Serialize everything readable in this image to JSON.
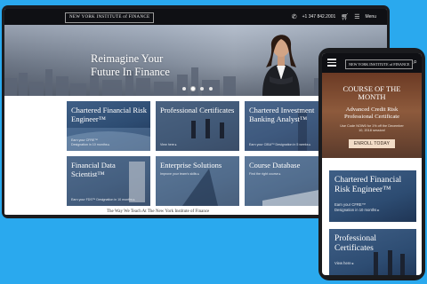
{
  "desktop": {
    "logo": "NEW YORK INSTITUTE of FINANCE",
    "phone": "+1 347 842.2001",
    "menu_label": "Menu",
    "hero_title_1": "Reimagine Your",
    "hero_title_2": "Future In Finance",
    "cards": [
      {
        "title": "Chartered Financial Risk Engineer™",
        "sub1": "Earn your CFRE™",
        "sub2": "Designation in 10 months ▸"
      },
      {
        "title": "Professional Certificates",
        "sub1": "View here ▸",
        "sub2": ""
      },
      {
        "title": "Chartered Investment Banking Analyst™",
        "sub1": "Earn your CIBA™ Designation in 5 weeks ▸",
        "sub2": ""
      },
      {
        "title": "Financial Data Scientist™",
        "sub1": "Earn your FDS™ Designation in 10 months ▸",
        "sub2": ""
      },
      {
        "title": "Enterprise Solutions",
        "sub1": "Improve your team's skills ▸",
        "sub2": ""
      },
      {
        "title": "Course Database",
        "sub1": "Find the right course ▸",
        "sub2": ""
      }
    ],
    "bottom_text": "The Way We Teach At The New York Institute of Finance"
  },
  "mobile": {
    "logo": "NEW YORK INSTITUTE of FINANCE",
    "hero_line_1": "COURSE OF THE",
    "hero_line_2": "MONTH",
    "cert_line_1": "Advanced Credit Risk",
    "cert_line_2": "Professional Certificate",
    "promo_1": "Use Code NOW6 for 1% off the December",
    "promo_2": "10, 2018 session!",
    "cta": "ENROLL TODAY",
    "cards": [
      {
        "title": "Chartered Financial Risk Engineer™",
        "sub1": "Earn your CFRE™",
        "sub2": "Designation in 10 months ▸"
      },
      {
        "title": "Professional Certificates",
        "sub1": "View here ▸",
        "sub2": ""
      }
    ]
  },
  "icons": [
    "phone-icon",
    "cart-icon",
    "menu-icon",
    "search-icon"
  ]
}
